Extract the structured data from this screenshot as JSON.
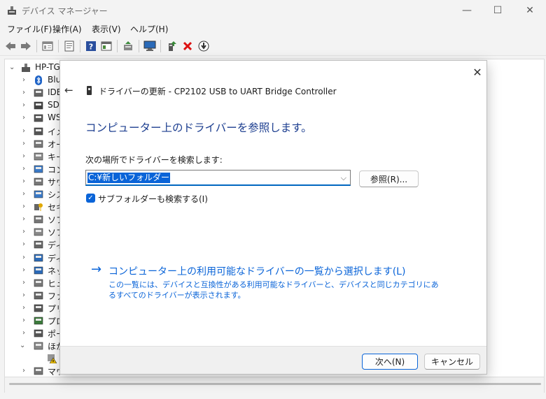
{
  "window": {
    "title": "デバイス マネージャー",
    "minimize_glyph": "—",
    "maximize_glyph": "☐",
    "close_glyph": "✕"
  },
  "menu": [
    {
      "label": "ファイル(F)"
    },
    {
      "label": "操作(A)"
    },
    {
      "label": "表示(V)"
    },
    {
      "label": "ヘルプ(H)"
    }
  ],
  "toolbar": {
    "icons": [
      "back-arrow-icon",
      "forward-arrow-icon",
      "properties-icon",
      "help-page-icon",
      "help-icon",
      "view-icon",
      "update-driver-icon",
      "scan-hardware-icon",
      "add-driver-icon",
      "uninstall-icon",
      "disable-device-icon"
    ]
  },
  "tree": {
    "root_label": "HP-TG",
    "items": [
      {
        "label": "Blu",
        "icon": "bluetooth-icon"
      },
      {
        "label": "IDE",
        "icon": "ide-controller-icon"
      },
      {
        "label": "SD",
        "icon": "sd-host-icon"
      },
      {
        "label": "WS",
        "icon": "wsd-printer-icon"
      },
      {
        "label": "イメ",
        "icon": "camera-icon"
      },
      {
        "label": "オー",
        "icon": "audio-icon"
      },
      {
        "label": "キー",
        "icon": "keyboard-icon"
      },
      {
        "label": "コン",
        "icon": "computer-icon"
      },
      {
        "label": "サウ",
        "icon": "sound-icon"
      },
      {
        "label": "シス",
        "icon": "system-icon"
      },
      {
        "label": "セキ",
        "icon": "security-icon"
      },
      {
        "label": "ソフ",
        "icon": "software-component-icon"
      },
      {
        "label": "ソフ",
        "icon": "software-device-icon"
      },
      {
        "label": "ディ",
        "icon": "disk-icon"
      },
      {
        "label": "ディ",
        "icon": "display-icon"
      },
      {
        "label": "ネッ",
        "icon": "network-icon"
      },
      {
        "label": "ヒュ",
        "icon": "hid-icon"
      },
      {
        "label": "ファ",
        "icon": "firmware-icon"
      },
      {
        "label": "プリ",
        "icon": "print-queue-icon"
      },
      {
        "label": "プロ",
        "icon": "processor-icon"
      },
      {
        "label": "ポー",
        "icon": "port-icon"
      },
      {
        "label": "ほか",
        "icon": "other-devices-icon"
      },
      {
        "label": "",
        "icon": "warning-device-icon"
      },
      {
        "label": "マウ",
        "icon": "mouse-icon"
      }
    ]
  },
  "dialog": {
    "close_glyph": "✕",
    "back_glyph": "←",
    "title": "ドライバーの更新 - CP2102 USB to UART Bridge Controller",
    "heading": "コンピューター上のドライバーを参照します。",
    "field_label": "次の場所でドライバーを検索します:",
    "path_value": "C:¥新しいフォルダー",
    "path_chevron": "⌵",
    "browse_label": "参照(R)...",
    "include_subfolders_label": "サブフォルダーも検索する(I)",
    "include_subfolders_checked": "✓",
    "pick_link": "コンピューター上の利用可能なドライバーの一覧から選択します(L)",
    "pick_link_arrow": "→",
    "pick_desc": "この一覧には、デバイスと互換性がある利用可能なドライバーと、デバイスと同じカテゴリにあるすべてのドライバーが表示されます。",
    "next_label": "次へ(N)",
    "cancel_label": "キャンセル"
  },
  "colors": {
    "accent": "#0a64d8",
    "heading": "#1b3d8f"
  }
}
